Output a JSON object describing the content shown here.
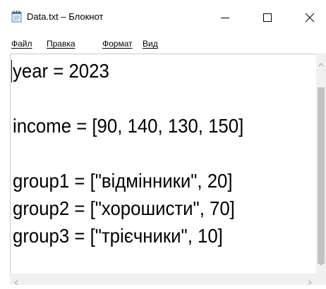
{
  "window": {
    "title": "Data.txt – Блокнот"
  },
  "menu": {
    "items": [
      "Файл",
      "Правка",
      "Формат",
      "Вид"
    ]
  },
  "editor": {
    "lines": [
      "year = 2023",
      "",
      "income = [90, 140, 130, 150]",
      "",
      "group1 = [\"відмінники\", 20]",
      "group2 = [\"хорошисти\", 70]",
      "group3 = [\"трієчники\", 10]"
    ]
  },
  "colors": {
    "text": "#000000",
    "scrollbar_track": "#f0f0f0",
    "scrollbar_thumb": "#c2c2c2"
  },
  "icons": {
    "app": "notepad-icon",
    "minimize": "minimize-icon",
    "maximize": "maximize-icon",
    "close": "close-icon"
  }
}
